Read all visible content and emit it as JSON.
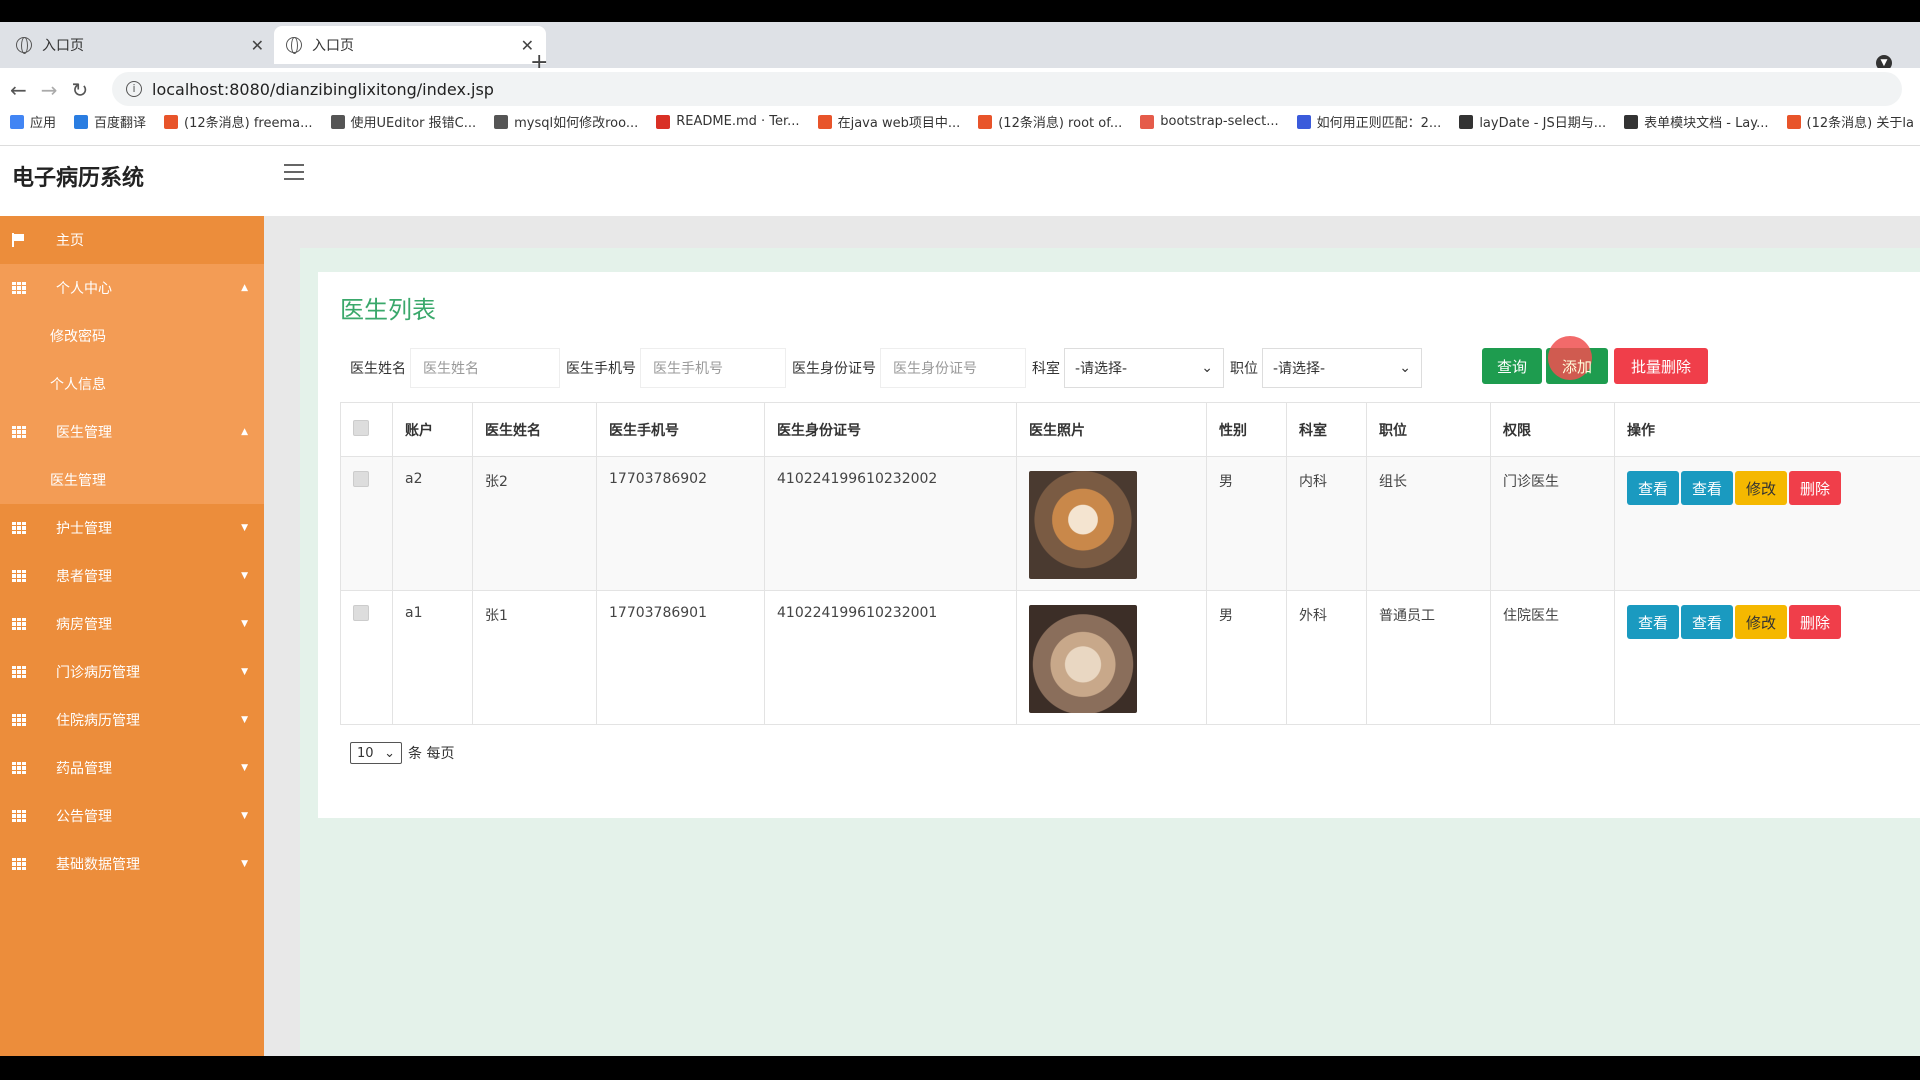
{
  "browser": {
    "tabs": [
      {
        "title": "入口页",
        "active": false
      },
      {
        "title": "入口页",
        "active": true
      }
    ],
    "url": "localhost:8080/dianzibinglixitong/index.jsp",
    "bookmarks": [
      {
        "label": "应用",
        "color": "#4285f4"
      },
      {
        "label": "百度翻译",
        "color": "#2a7de1"
      },
      {
        "label": "(12条消息) freema...",
        "color": "#e8542a"
      },
      {
        "label": "使用UEditor 报错C...",
        "color": "#555555"
      },
      {
        "label": "mysql如何修改roo...",
        "color": "#555555"
      },
      {
        "label": "README.md · Ter...",
        "color": "#d93025"
      },
      {
        "label": "在java web项目中...",
        "color": "#e8542a"
      },
      {
        "label": "(12条消息) root of...",
        "color": "#e8542a"
      },
      {
        "label": "bootstrap-select...",
        "color": "#e55b4a"
      },
      {
        "label": "如何用正则匹配：2...",
        "color": "#3b5bdb"
      },
      {
        "label": "layDate - JS日期与...",
        "color": "#333333"
      },
      {
        "label": "表单模块文档 - Lay...",
        "color": "#333333"
      },
      {
        "label": "(12条消息) 关于la",
        "color": "#e8542a"
      }
    ]
  },
  "app": {
    "brand": "电子病历系统",
    "accent": "#ec8d3b"
  },
  "sidebar": {
    "items": [
      {
        "label": "主页",
        "icon": "flag-icon"
      },
      {
        "label": "个人中心",
        "icon": "grid-icon",
        "expanded": true,
        "children": [
          "修改密码",
          "个人信息"
        ]
      },
      {
        "label": "医生管理",
        "icon": "grid-icon",
        "expanded": true,
        "children": [
          "医生管理"
        ]
      },
      {
        "label": "护士管理",
        "icon": "grid-icon"
      },
      {
        "label": "患者管理",
        "icon": "grid-icon"
      },
      {
        "label": "病房管理",
        "icon": "grid-icon"
      },
      {
        "label": "门诊病历管理",
        "icon": "grid-icon"
      },
      {
        "label": "住院病历管理",
        "icon": "grid-icon"
      },
      {
        "label": "药品管理",
        "icon": "grid-icon"
      },
      {
        "label": "公告管理",
        "icon": "grid-icon"
      },
      {
        "label": "基础数据管理",
        "icon": "grid-icon"
      }
    ]
  },
  "panel": {
    "title": "医生列表",
    "filters": {
      "name_label": "医生姓名",
      "name_placeholder": "医生姓名",
      "phone_label": "医生手机号",
      "phone_placeholder": "医生手机号",
      "id_label": "医生身份证号",
      "id_placeholder": "医生身份证号",
      "dept_label": "科室",
      "dept_value": "-请选择-",
      "position_label": "职位",
      "position_value": "-请选择-"
    },
    "buttons": {
      "query": "查询",
      "add": "添加",
      "bulk_delete": "批量删除"
    },
    "columns": [
      "账户",
      "医生姓名",
      "医生手机号",
      "医生身份证号",
      "医生照片",
      "性别",
      "科室",
      "职位",
      "权限",
      "操作"
    ],
    "rows": [
      {
        "account": "a2",
        "name": "张2",
        "phone": "17703786902",
        "idcard": "410224199610232002",
        "photo": "shiba-dog-photo",
        "gender": "男",
        "dept": "内科",
        "position": "组长",
        "role": "门诊医生"
      },
      {
        "account": "a1",
        "name": "张1",
        "phone": "17703786901",
        "idcard": "410224199610232001",
        "photo": "cat-photo",
        "gender": "男",
        "dept": "外科",
        "position": "普通员工",
        "role": "住院医生"
      }
    ],
    "row_actions": {
      "view": "查看",
      "view2": "查看",
      "edit": "修改",
      "delete": "删除"
    },
    "pager": {
      "page_size": "10",
      "suffix": "条 每页"
    }
  }
}
